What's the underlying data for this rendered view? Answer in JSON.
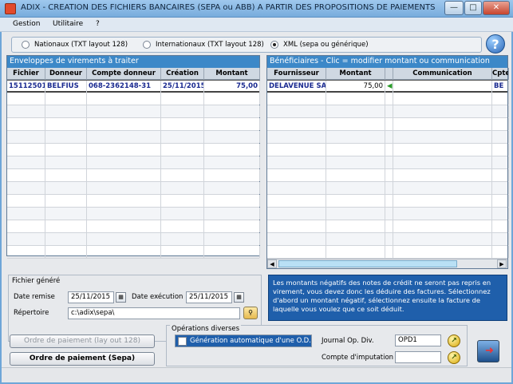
{
  "window": {
    "title": "ADIX - CREATION DES FICHIERS BANCAIRES (SEPA ou ABB) A PARTIR DES PROPOSITIONS DE PAIEMENTS FOURNI...",
    "minimize_glyph": "—",
    "maximize_glyph": "□",
    "close_glyph": "✕"
  },
  "menu": [
    {
      "label": "Gestion"
    },
    {
      "label": "Utilitaire"
    },
    {
      "label": "?"
    }
  ],
  "format_options": [
    {
      "label": "Nationaux (TXT layout 128)",
      "selected": false
    },
    {
      "label": "Internationaux (TXT layout 128)",
      "selected": false
    },
    {
      "label": "XML (sepa ou générique)",
      "selected": true
    }
  ],
  "help_glyph": "?",
  "envelopes": {
    "title": "Enveloppes de virements à traiter",
    "columns": [
      "Fichier",
      "Donneur",
      "Compte donneur",
      "Création",
      "Montant"
    ],
    "rows": [
      {
        "fichier": "15112501",
        "donneur": "BELFIUS",
        "compte": "068-2362148-31",
        "creation": "25/11/2015",
        "montant": "75,00"
      }
    ]
  },
  "beneficiaires": {
    "title": "Bénéficiaires  -  Clic = modifier montant ou communication",
    "columns": [
      "Fournisseur",
      "Montant",
      "Communication",
      "Cpte"
    ],
    "rows": [
      {
        "fournisseur": "DELAVENUE SA",
        "montant": "75,00",
        "communication": "",
        "cpte": "BE"
      }
    ]
  },
  "fichier_genere": {
    "title": "Fichier généré",
    "date_remise_label": "Date remise",
    "date_remise": "25/11/2015",
    "date_execution_label": "Date exécution",
    "date_execution": "25/11/2015",
    "repertoire_label": "Répertoire",
    "repertoire": "c:\\adix\\sepa\\"
  },
  "note": "Les montants négatifs des notes de crédit ne seront pas repris en virement, vous devez donc les déduire des factures. Sélectionnez d'abord un montant négatif, sélectionnez ensuite la facture de laquelle vous voulez que ce soit déduit.",
  "buttons": {
    "ordre_layout": "Ordre de paiement (lay out 128)",
    "ordre_sepa": "Ordre de paiement (Sepa)"
  },
  "operations": {
    "title": "Opérations diverses",
    "generation_label": "Génération automatique d'une O.D.",
    "journal_label": "Journal Op. Div.",
    "journal_value": "OPD1",
    "compte_label": "Compte d'imputation",
    "compte_value": ""
  },
  "colors": {
    "accent": "#3c88c8",
    "note_bg": "#1f5fab",
    "selected_text": "#1a2a90"
  }
}
